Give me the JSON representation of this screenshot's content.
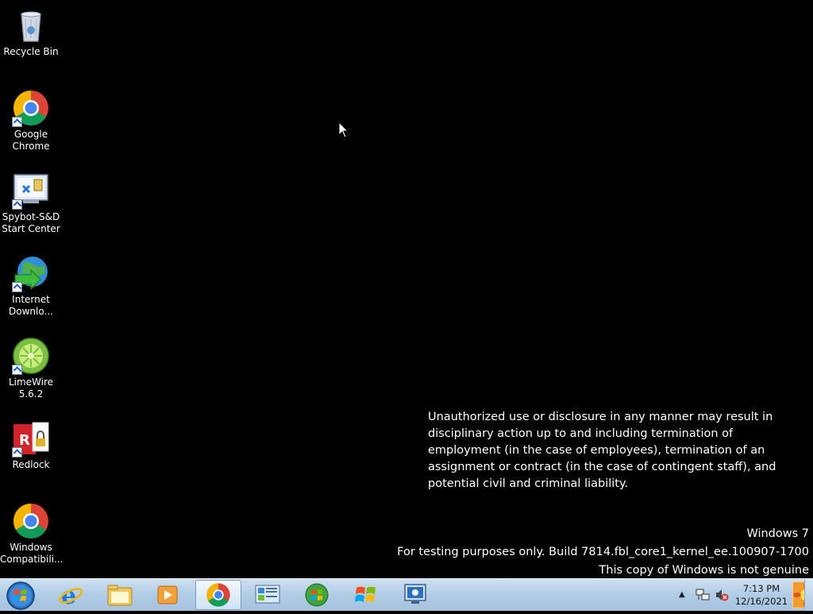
{
  "desktop_icons": [
    {
      "label": "Recycle Bin",
      "icon": "recycle-bin-icon"
    },
    {
      "label": "Google\nChrome",
      "icon": "chrome-icon"
    },
    {
      "label": "Spybot-S&D\nStart Center",
      "icon": "spybot-icon"
    },
    {
      "label": "Internet\nDownlo...",
      "icon": "internet-download-manager-icon"
    },
    {
      "label": "LimeWire\n5.6.2",
      "icon": "limewire-icon"
    },
    {
      "label": "Redlock",
      "icon": "redlock-icon"
    },
    {
      "label": "Windows\nCompatibili...",
      "icon": "chrome-icon"
    }
  ],
  "notice": {
    "text": "Unauthorized use or disclosure in any manner may result in disciplinary action up to and including termination of employment (in the case of employees), termination of an assignment or contract (in the case of contingent staff), and potential civil and criminal liability."
  },
  "watermark": {
    "os": "Windows 7",
    "build": "For testing purposes only. Build 7814.fbl_core1_kernel_ee.100907-1700",
    "genuine": "This copy of Windows is not genuine"
  },
  "taskbar": {
    "pinned": [
      {
        "name": "internet-explorer-icon"
      },
      {
        "name": "windows-explorer-icon"
      },
      {
        "name": "media-player-icon"
      },
      {
        "name": "chrome-icon",
        "active": true
      },
      {
        "name": "control-panel-icon"
      },
      {
        "name": "windows-orb-green-icon"
      },
      {
        "name": "windows-flag-icon"
      },
      {
        "name": "monitor-icon"
      }
    ],
    "clock": {
      "time": "7:13 PM",
      "date": "12/16/2021"
    },
    "tray_icons": [
      "show-hidden-icons",
      "network-icon",
      "volume-muted-icon"
    ]
  },
  "colors": {
    "desktop_background": "#000000",
    "taskbar": "#b4cde6"
  }
}
